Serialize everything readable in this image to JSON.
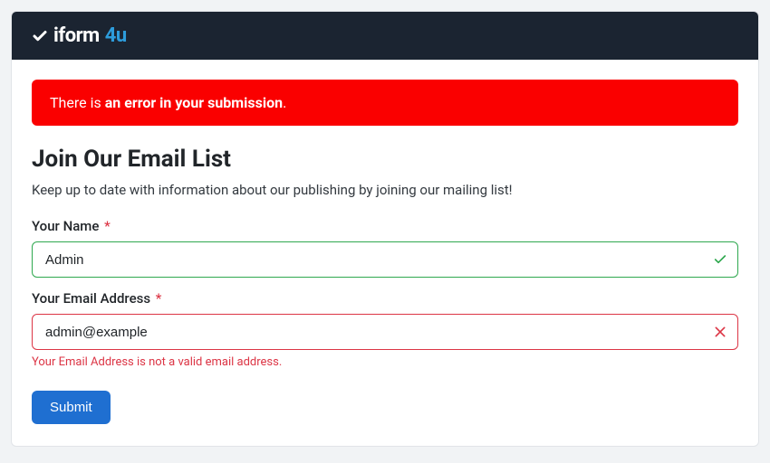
{
  "brand": {
    "part1": "iform",
    "part2": "4u"
  },
  "alert": {
    "prefix": "There is ",
    "bold": "an error in your submission",
    "suffix": "."
  },
  "form": {
    "title": "Join Our Email List",
    "description": "Keep up to date with information about our publishing by joining our mailing list!",
    "name": {
      "label": "Your Name",
      "required": "*",
      "value": "Admin"
    },
    "email": {
      "label": "Your Email Address",
      "required": "*",
      "value": "admin@example",
      "error": "Your Email Address is not a valid email address."
    },
    "submit_label": "Submit"
  }
}
